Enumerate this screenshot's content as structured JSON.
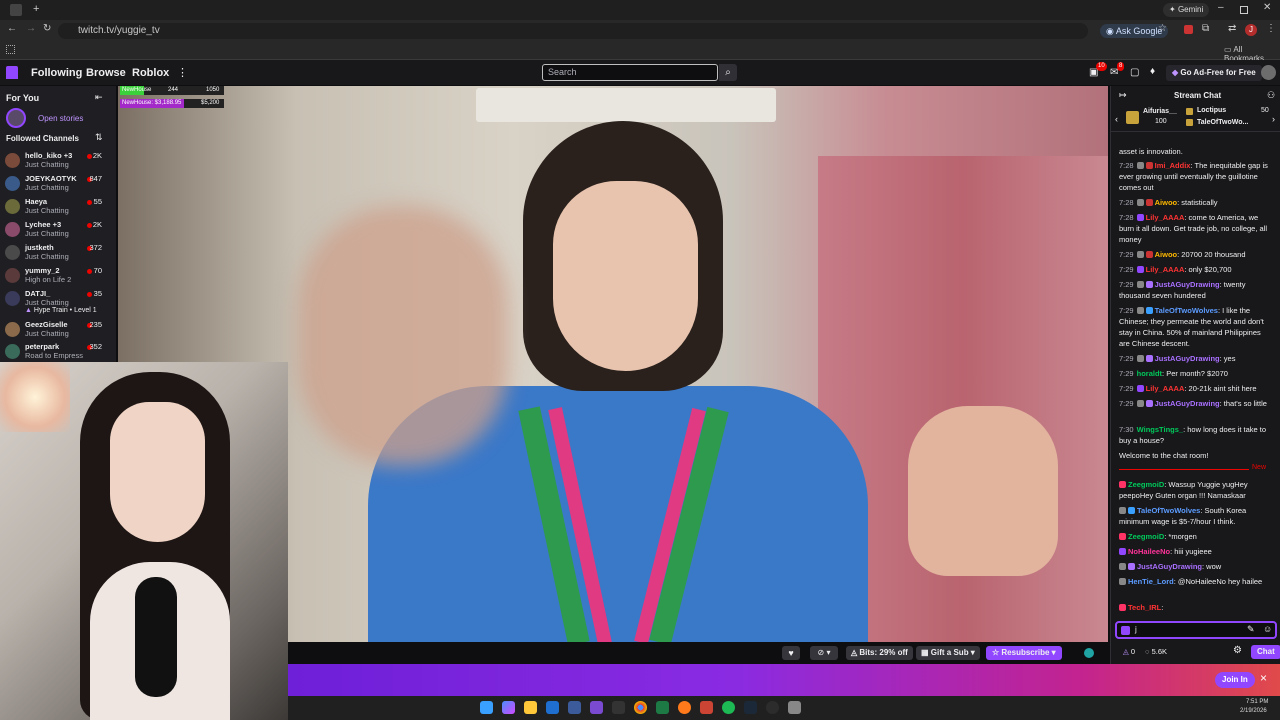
{
  "browser": {
    "url": "twitch.tv/yuggie_tv",
    "gemini_label": "Gemini",
    "ask_google_label": "Ask Google",
    "profile_letter": "J",
    "all_bookmarks_label": "All Bookmarks"
  },
  "nav": {
    "following": "Following",
    "browse": "Browse",
    "roblox": "Roblox",
    "search_placeholder": "Search",
    "notif_count": "10",
    "whisper_count": "8",
    "ad_free": "Go Ad-Free for Free"
  },
  "sidebar": {
    "for_you": "For You",
    "open_stories": "Open stories",
    "followed_channels": "Followed Channels",
    "channels": [
      {
        "name": "hello_kiko +3",
        "category": "Just Chatting",
        "viewers": "2K",
        "color": "#7a4a3a"
      },
      {
        "name": "JOEYKAOTYK",
        "category": "Just Chatting",
        "viewers": "847",
        "color": "#3a5a8a"
      },
      {
        "name": "Haeya",
        "category": "Just Chatting",
        "viewers": "55",
        "color": "#6a6a3a"
      },
      {
        "name": "Lychee +3",
        "category": "Just Chatting",
        "viewers": "2K",
        "color": "#8a4a6a"
      },
      {
        "name": "justketh",
        "category": "Just Chatting",
        "viewers": "372",
        "color": "#4a4a4a"
      },
      {
        "name": "yummy_2",
        "category": "High on Life 2",
        "viewers": "70",
        "color": "#5a3a3a"
      },
      {
        "name": "DATJI_",
        "category": "Just Chatting",
        "viewers": "35",
        "color": "#3a3a5a"
      },
      {
        "name": "GeezGiselle",
        "category": "Just Chatting",
        "viewers": "235",
        "color": "#8a6a4a"
      },
      {
        "name": "peterpark",
        "category": "Road to Empress",
        "viewers": "352",
        "color": "#3a6a5a"
      }
    ],
    "hype_train": "Hype Train • Level 1"
  },
  "overlay": {
    "row1_label": "NewHouse",
    "row1_val1": "244",
    "row1_val2": "1050",
    "row2_label": "NewHouse: $3,188.95",
    "row2_val": "$5,200"
  },
  "controls": {
    "bits": "Bits: 29% off",
    "gift_sub": "Gift a Sub",
    "resubscribe": "Resubscribe"
  },
  "promo": {
    "join_label": "Join In",
    "close": "×"
  },
  "chat": {
    "title": "Stream Chat",
    "leaders": [
      {
        "name": "Aifurias__",
        "amount": "100"
      },
      {
        "name": "Loctipus",
        "amount": "50"
      },
      {
        "name": "TaleOfTwoWo...",
        "amount": ""
      }
    ],
    "partial_top": "asset is innovation.",
    "messages": [
      {
        "time": "7:28",
        "user": "Imi_Addix",
        "color": "#ff3333",
        "text": ": The inequitable gap is ever growing until eventually the guillotine comes out"
      },
      {
        "time": "7:28",
        "user": "Aiwoo",
        "color": "#ffb800",
        "text": ": statistically"
      },
      {
        "time": "7:28",
        "user": "Lily_AAAA",
        "color": "#ff3333",
        "text": ": come to America, we burn it all down. Get trade job, no college, all money"
      },
      {
        "time": "7:29",
        "user": "Aiwoo",
        "color": "#ffb800",
        "text": ": 20700 20 thousand"
      },
      {
        "time": "7:29",
        "user": "Lily_AAAA",
        "color": "#ff3333",
        "text": ": only $20,700"
      },
      {
        "time": "7:29",
        "user": "JustAGuyDrawing",
        "color": "#a970ff",
        "text": ": twenty thousand seven hundered"
      },
      {
        "time": "7:29",
        "user": "TaleOfTwoWolves",
        "color": "#5c9cff",
        "text": ": I like the Chinese; they permeate the world and don't stay in China. 50% of mainland Philippines are Chinese descent."
      },
      {
        "time": "7:29",
        "user": "JustAGuyDrawing",
        "color": "#a970ff",
        "text": ": yes"
      },
      {
        "time": "7:29",
        "user": "horaldt",
        "color": "#00c85a",
        "text": ": Per month? $2070"
      },
      {
        "time": "7:29",
        "user": "Lily_AAAA",
        "color": "#ff3333",
        "text": ": 20-21k aint shit here"
      },
      {
        "time": "7:29",
        "user": "JustAGuyDrawing",
        "color": "#a970ff",
        "text": ": that's so little"
      },
      {
        "time": "7:30",
        "user": "WingsTings_",
        "color": "#00c85a",
        "text": ": how long does it take to buy a house?"
      }
    ],
    "welcome": "Welcome to the chat room!",
    "new_label": "New",
    "new_messages": [
      {
        "user": "ZeegmoiD",
        "color": "#00c85a",
        "text": ": Wassup Yuggie yugHey peepoHey Guten organ !!! Namaskaar"
      },
      {
        "user": "TaleOfTwoWolves",
        "color": "#5c9cff",
        "text": ": South Korea minimum wage is $5-7/hour I think."
      },
      {
        "user": "ZeegmoiD",
        "color": "#00c85a",
        "text": ": *morgen"
      },
      {
        "user": "NoHaileeNo",
        "color": "#ff3399",
        "text": ": hiii yugieee"
      },
      {
        "user": "JustAGuyDrawing",
        "color": "#a970ff",
        "text": ": wow"
      },
      {
        "user": "HenTie_Lord",
        "color": "#5c9cff",
        "text": ": @NoHaileeNo hey hailee"
      },
      {
        "user": "Tech_IRL",
        "color": "#ff3333",
        "text": ":"
      }
    ],
    "input_value": "j",
    "points": "0",
    "points2": "5.6K",
    "chat_button": "Chat"
  },
  "taskbar": {
    "time": "7:51 PM",
    "date": "2/19/2026"
  }
}
